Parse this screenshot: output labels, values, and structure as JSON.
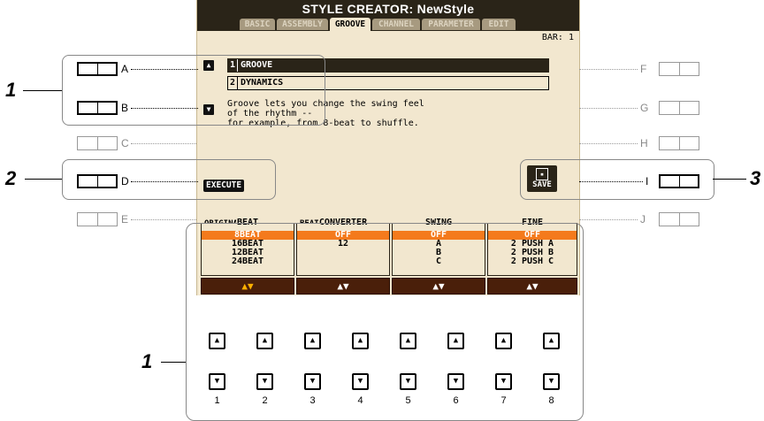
{
  "screen": {
    "title": "STYLE CREATOR: NewStyle",
    "tabs": [
      {
        "label": "BASIC",
        "active": false
      },
      {
        "label": "ASSEMBLY",
        "active": false
      },
      {
        "label": "GROOVE",
        "active": true
      },
      {
        "label": "CHANNEL",
        "active": false
      },
      {
        "label": "PARAMETER",
        "active": false
      },
      {
        "label": "EDIT",
        "active": false
      }
    ],
    "bar_label": "BAR:  1",
    "menu": [
      {
        "num": "1",
        "label": "GROOVE",
        "selected": true
      },
      {
        "num": "2",
        "label": "DYNAMICS",
        "selected": false
      }
    ],
    "description": "Groove lets you change the swing feel\nof the rhythm --\nfor example, from 8-beat to shuffle.",
    "execute_label": "EXECUTE",
    "save_label": "SAVE",
    "original_label_1": "ORIGINAL",
    "original_label_2": "BEAT",
    "columns": [
      {
        "header": "BEAT",
        "items": [
          "8BEAT",
          "16BEAT",
          "12BEAT",
          "24BEAT"
        ],
        "selected": "8BEAT"
      },
      {
        "header": "CONVERTER",
        "items": [
          "OFF",
          "12"
        ],
        "selected": "OFF"
      },
      {
        "header": "SWING",
        "items": [
          "OFF",
          "A",
          "B",
          "C"
        ],
        "selected": "OFF"
      },
      {
        "header": "FINE",
        "items": [
          "OFF",
          "2 PUSH A",
          "2 PUSH B",
          "2 PUSH C"
        ],
        "selected": "OFF"
      }
    ],
    "column_arrows": "▲▼"
  },
  "panel": {
    "left_buttons": [
      "A",
      "B",
      "C",
      "D",
      "E"
    ],
    "right_buttons": [
      "F",
      "G",
      "H",
      "I",
      "J"
    ],
    "knob_numbers": [
      "1",
      "2",
      "3",
      "4",
      "5",
      "6",
      "7",
      "8"
    ],
    "knob_up": "▲",
    "knob_down": "▼",
    "callouts": [
      "1",
      "2",
      "3",
      "1"
    ]
  },
  "colors": {
    "lcd_bg": "#f2e7cf",
    "lcd_dark": "#2a2418",
    "highlight": "#f47a1c",
    "bar": "#4a1f0a"
  }
}
